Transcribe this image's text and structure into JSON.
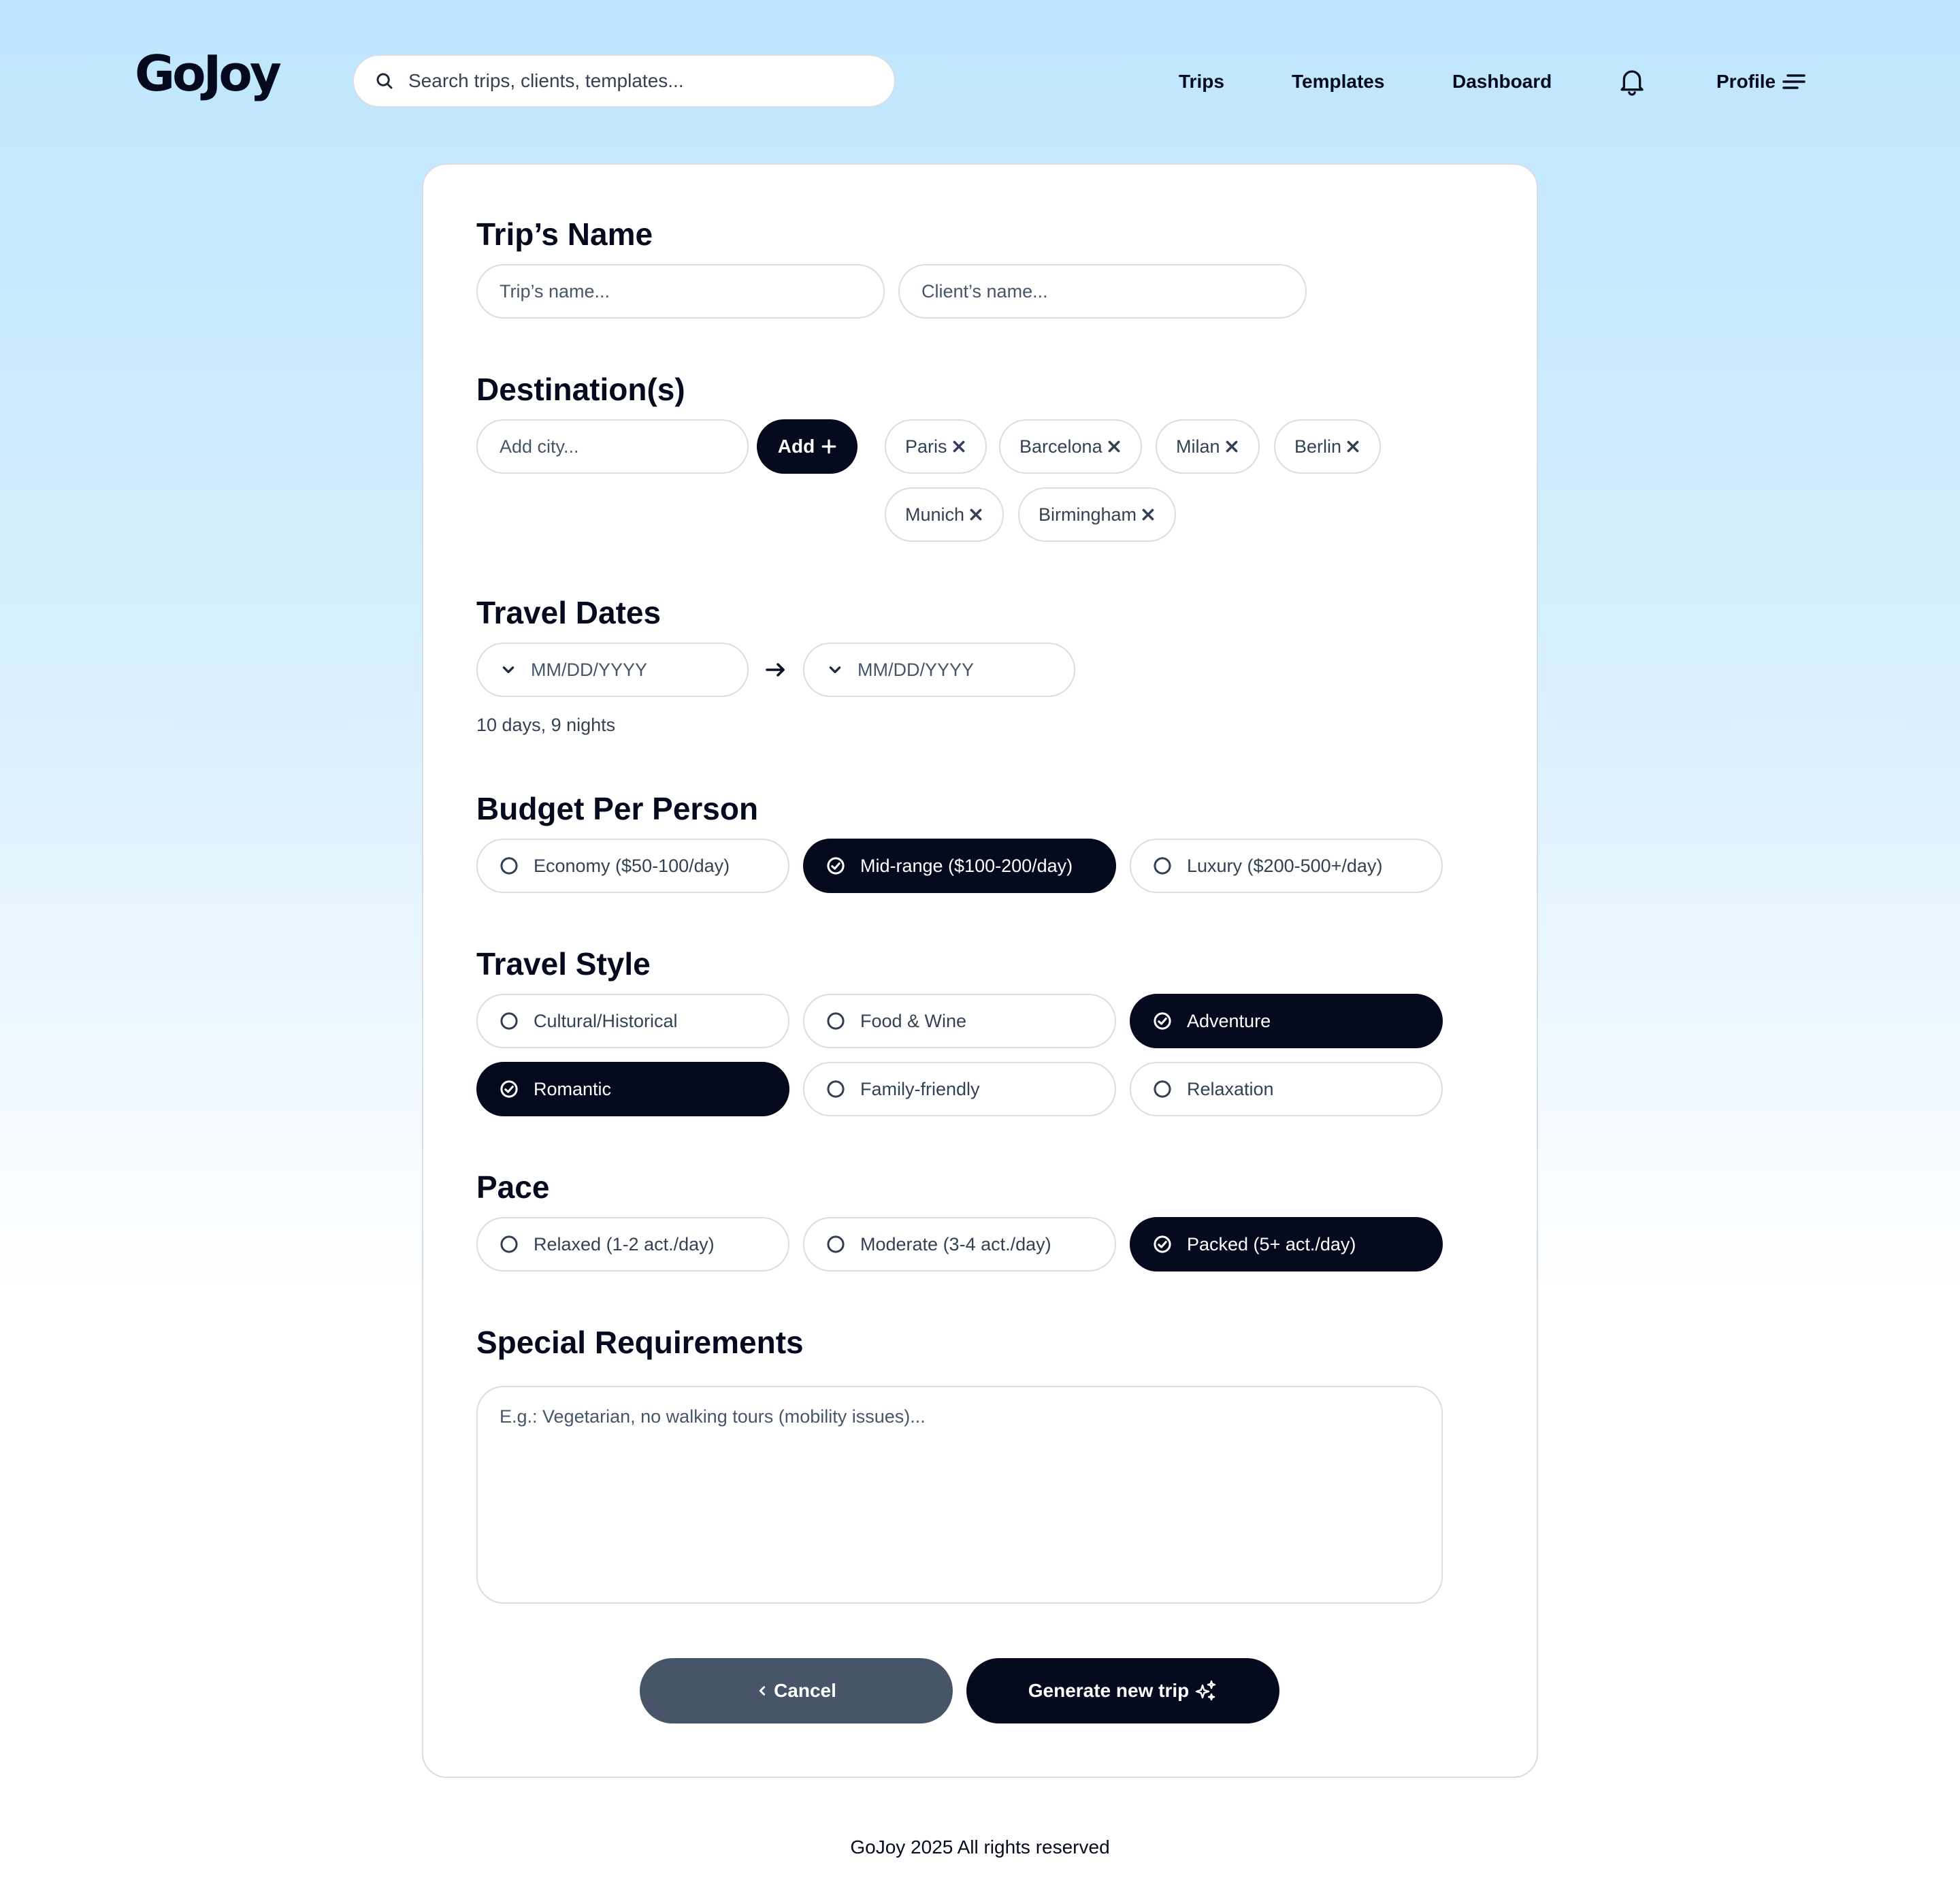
{
  "brand": {
    "logo": "GoJoy"
  },
  "header": {
    "search_placeholder": "Search trips, clients, templates...",
    "nav": {
      "trips": "Trips",
      "templates": "Templates",
      "dashboard": "Dashboard"
    },
    "profile_label": "Profile"
  },
  "form": {
    "trip_name": {
      "title": "Trip’s Name",
      "trip_placeholder": "Trip’s name...",
      "client_placeholder": "Client’s name..."
    },
    "destinations": {
      "title": "Destination(s)",
      "city_placeholder": "Add city...",
      "add_label": "Add",
      "cities": [
        "Paris",
        "Barcelona",
        "Milan",
        "Berlin",
        "Munich",
        "Birmingham"
      ]
    },
    "dates": {
      "title": "Travel Dates",
      "start_placeholder": "MM/DD/YYYY",
      "end_placeholder": "MM/DD/YYYY",
      "duration": "10 days, 9 nights"
    },
    "budget": {
      "title": "Budget Per Person",
      "options": [
        {
          "label": "Economy ($50-100/day)",
          "selected": false
        },
        {
          "label": "Mid-range ($100-200/day)",
          "selected": true
        },
        {
          "label": "Luxury ($200-500+/day)",
          "selected": false
        }
      ]
    },
    "style": {
      "title": "Travel Style",
      "options": [
        {
          "label": "Cultural/Historical",
          "selected": false
        },
        {
          "label": "Food & Wine",
          "selected": false
        },
        {
          "label": "Adventure",
          "selected": true
        },
        {
          "label": "Romantic",
          "selected": true
        },
        {
          "label": "Family-friendly",
          "selected": false
        },
        {
          "label": "Relaxation",
          "selected": false
        }
      ]
    },
    "pace": {
      "title": "Pace",
      "options": [
        {
          "label": "Relaxed (1-2 act./day)",
          "selected": false
        },
        {
          "label": "Moderate (3-4 act./day)",
          "selected": false
        },
        {
          "label": "Packed (5+ act./day)",
          "selected": true
        }
      ]
    },
    "requirements": {
      "title": "Special Requirements",
      "placeholder": "E.g.: Vegetarian, no walking tours (mobility issues)..."
    },
    "actions": {
      "cancel_label": "Cancel",
      "generate_label": "Generate new trip"
    }
  },
  "footer": {
    "text": "GoJoy 2025 All rights reserved"
  },
  "colors": {
    "primary": "#050a1f",
    "cancel": "#475569",
    "border": "#d5dde6",
    "background_top": "#bfe6fd"
  },
  "icons": {
    "search": "search-icon",
    "bell": "bell-icon",
    "menu": "menu-icon",
    "plus": "plus-icon",
    "close": "close-icon",
    "chevron": "chevron-down-icon",
    "arrow": "arrow-right-icon",
    "radio_off": "radio-empty-icon",
    "radio_on": "check-circle-icon",
    "back": "chevron-left-icon",
    "sparkle": "sparkle-icon"
  }
}
